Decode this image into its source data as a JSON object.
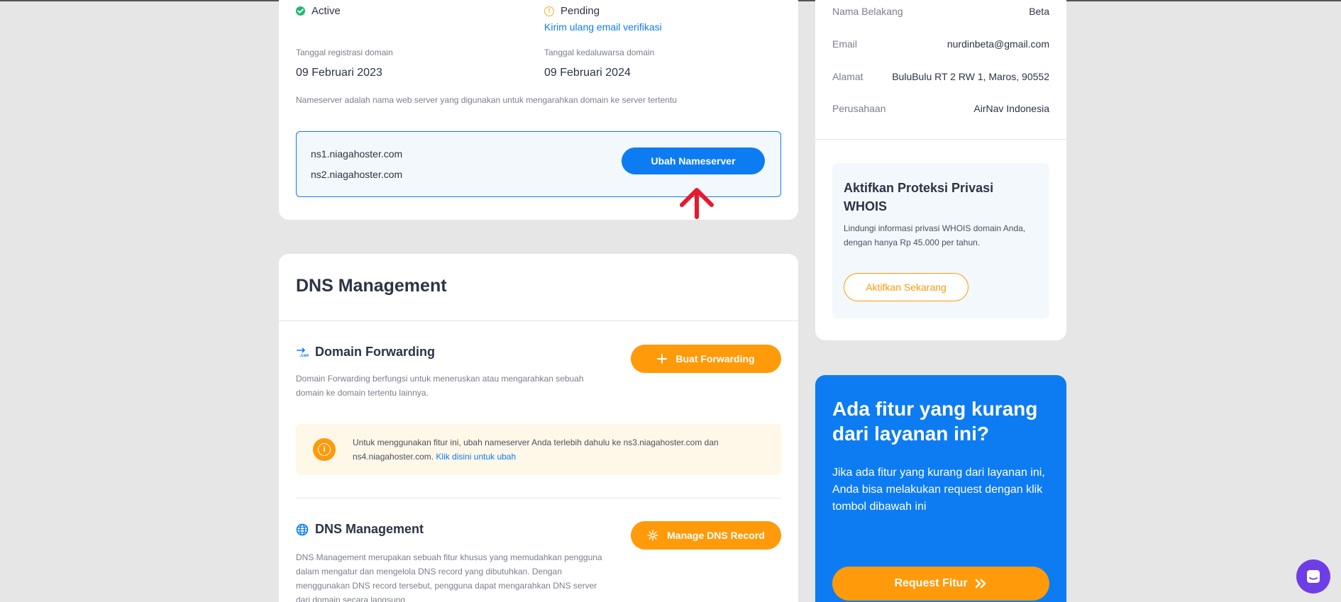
{
  "domain_info": {
    "status_left": "Active",
    "status_right": "Pending",
    "resend_link": "Kirim ulang email verifikasi",
    "reg_label": "Tanggal registrasi domain",
    "reg_date": "09 Februari 2023",
    "exp_label": "Tanggal kedaluwarsa domain",
    "exp_date": "09 Februari 2024",
    "ns_note": "Nameserver adalah nama web server yang digunakan untuk mengarahkan domain ke server tertentu",
    "ns1": "ns1.niagahoster.com",
    "ns2": "ns2.niagahoster.com",
    "change_ns_button": "Ubah Nameserver"
  },
  "dns": {
    "title": "DNS Management",
    "forwarding": {
      "title": "Domain Forwarding",
      "description": "Domain Forwarding berfungsi untuk meneruskan atau mengarahkan sebuah domain ke domain tertentu lainnya.",
      "button": "Buat Forwarding",
      "info_text": "Untuk menggunakan fitur ini, ubah nameserver Anda terlebih dahulu ke ns3.niagahoster.com dan ns4.niagahoster.com.",
      "info_link": "Klik disini untuk ubah"
    },
    "management": {
      "title": "DNS Management",
      "description": "DNS Management merupakan sebuah fitur khusus yang memudahkan pengguna dalam mengatur dan mengelola DNS record yang dibutuhkan. Dengan menggunakan DNS record tersebut, pengguna dapat mengarahkan DNS server dari domain secara langsung.",
      "button": "Manage DNS Record"
    }
  },
  "contact": {
    "rows": [
      {
        "key": "Nama Belakang",
        "value": "Beta"
      },
      {
        "key": "Email",
        "value": "nurdinbeta@gmail.com"
      },
      {
        "key": "Alamat",
        "value": "BuluBulu RT 2 RW 1, Maros, 90552"
      },
      {
        "key": "Perusahaan",
        "value": "AirNav Indonesia"
      }
    ]
  },
  "privacy_promo": {
    "title": "Aktifkan Proteksi Privasi WHOIS",
    "description": "Lindungi informasi privasi WHOIS domain Anda, dengan hanya Rp 45.000 per tahun.",
    "button": "Aktifkan Sekarang"
  },
  "feature_request": {
    "title": "Ada fitur yang kurang dari layanan ini?",
    "description": "Jika ada fitur yang kurang dari layanan ini, Anda bisa melakukan request dengan klik tombol dibawah ini",
    "button": "Request Fitur"
  },
  "colors": {
    "primary": "#0d7cf2",
    "accent": "#ff9a0a",
    "success": "#1fb870",
    "warning": "#f2b01e",
    "annotation": "#e8192c",
    "chat": "#6d3ee6"
  },
  "icons": [
    "check-circle-icon",
    "warning-circle-icon",
    "forwarding-icon",
    "plus-icon",
    "globe-icon",
    "gear-icon",
    "info-icon",
    "double-chevron-right-icon",
    "chat-icon",
    "up-arrow-annotation"
  ]
}
